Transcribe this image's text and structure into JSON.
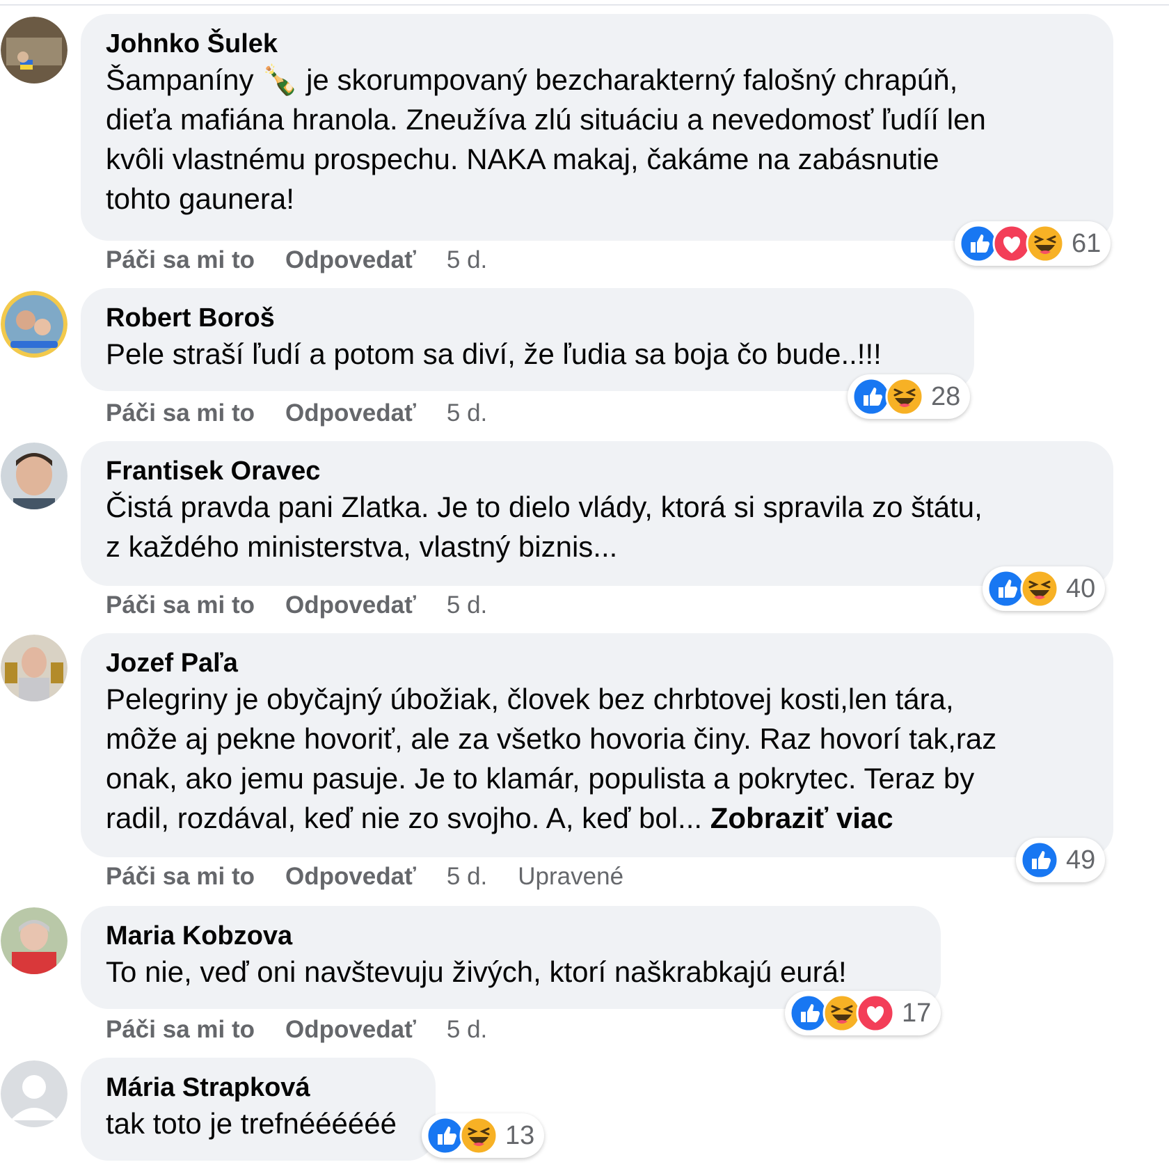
{
  "comments": [
    {
      "author": "Johnko Šulek",
      "text_lines": [
        "Šampaníny 🍾 je skorumpovaný bezcharakterný falošný chrapúň,",
        "dieťa mafiána hranola. Zneužíva zlú situáciu a nevedomosť ľudíí len",
        "kvôli vlastnému prospechu. NAKA makaj, čakáme na zabásnutie",
        "tohto gaunera!"
      ],
      "like": "Páči sa mi to",
      "reply": "Odpovedať",
      "time": "5 d.",
      "reactions": [
        "like-icon",
        "love-icon",
        "haha-icon"
      ],
      "reaction_count": "61"
    },
    {
      "author": "Robert Boroš",
      "text_lines": [
        "Pele straší ľudí a potom sa diví, že ľudia sa boja čo bude..!!!"
      ],
      "like": "Páči sa mi to",
      "reply": "Odpovedať",
      "time": "5 d.",
      "reactions": [
        "like-icon",
        "haha-icon"
      ],
      "reaction_count": "28"
    },
    {
      "author": "Frantisek Oravec",
      "text_lines": [
        "Čistá pravda pani Zlatka. Je to dielo vlády, ktorá si spravila zo štátu,",
        "z každého ministerstva, vlastný biznis..."
      ],
      "like": "Páči sa mi to",
      "reply": "Odpovedať",
      "time": "5 d.",
      "reactions": [
        "like-icon",
        "haha-icon"
      ],
      "reaction_count": "40"
    },
    {
      "author": "Jozef Paľa",
      "text_lines": [
        "Pelegriny je obyčajný úbožiak, človek bez chrbtovej kosti,len tára,",
        "môže aj pekne hovoriť, ale za všetko hovoria činy. Raz hovorí tak,raz",
        "onak, ako jemu pasuje. Je to klamár, populista a pokrytec. Teraz by",
        "radil, rozdával, keď nie zo svojho. A, keď bol..."
      ],
      "more": "Zobraziť viac",
      "like": "Páči sa mi to",
      "reply": "Odpovedať",
      "time": "5 d.",
      "edited": "Upravené",
      "reactions": [
        "like-icon"
      ],
      "reaction_count": "49"
    },
    {
      "author": "Maria Kobzova",
      "text_lines": [
        "To nie, veď oni navštevuju živých, ktorí naškrabkajú eurá!"
      ],
      "like": "Páči sa mi to",
      "reply": "Odpovedať",
      "time": "5 d.",
      "reactions": [
        "like-icon",
        "haha-icon",
        "love-icon"
      ],
      "reaction_count": "17"
    },
    {
      "author": "Mária Strapková",
      "text_lines": [
        "tak toto je trefnéééééé"
      ],
      "reactions": [
        "like-icon",
        "haha-icon"
      ],
      "reaction_count": "13"
    }
  ],
  "colors": {
    "bubble": "#f0f2f5",
    "meta": "#65676b",
    "like": "#1877f2",
    "love": "#f33e58",
    "haha": "#f7b125"
  }
}
